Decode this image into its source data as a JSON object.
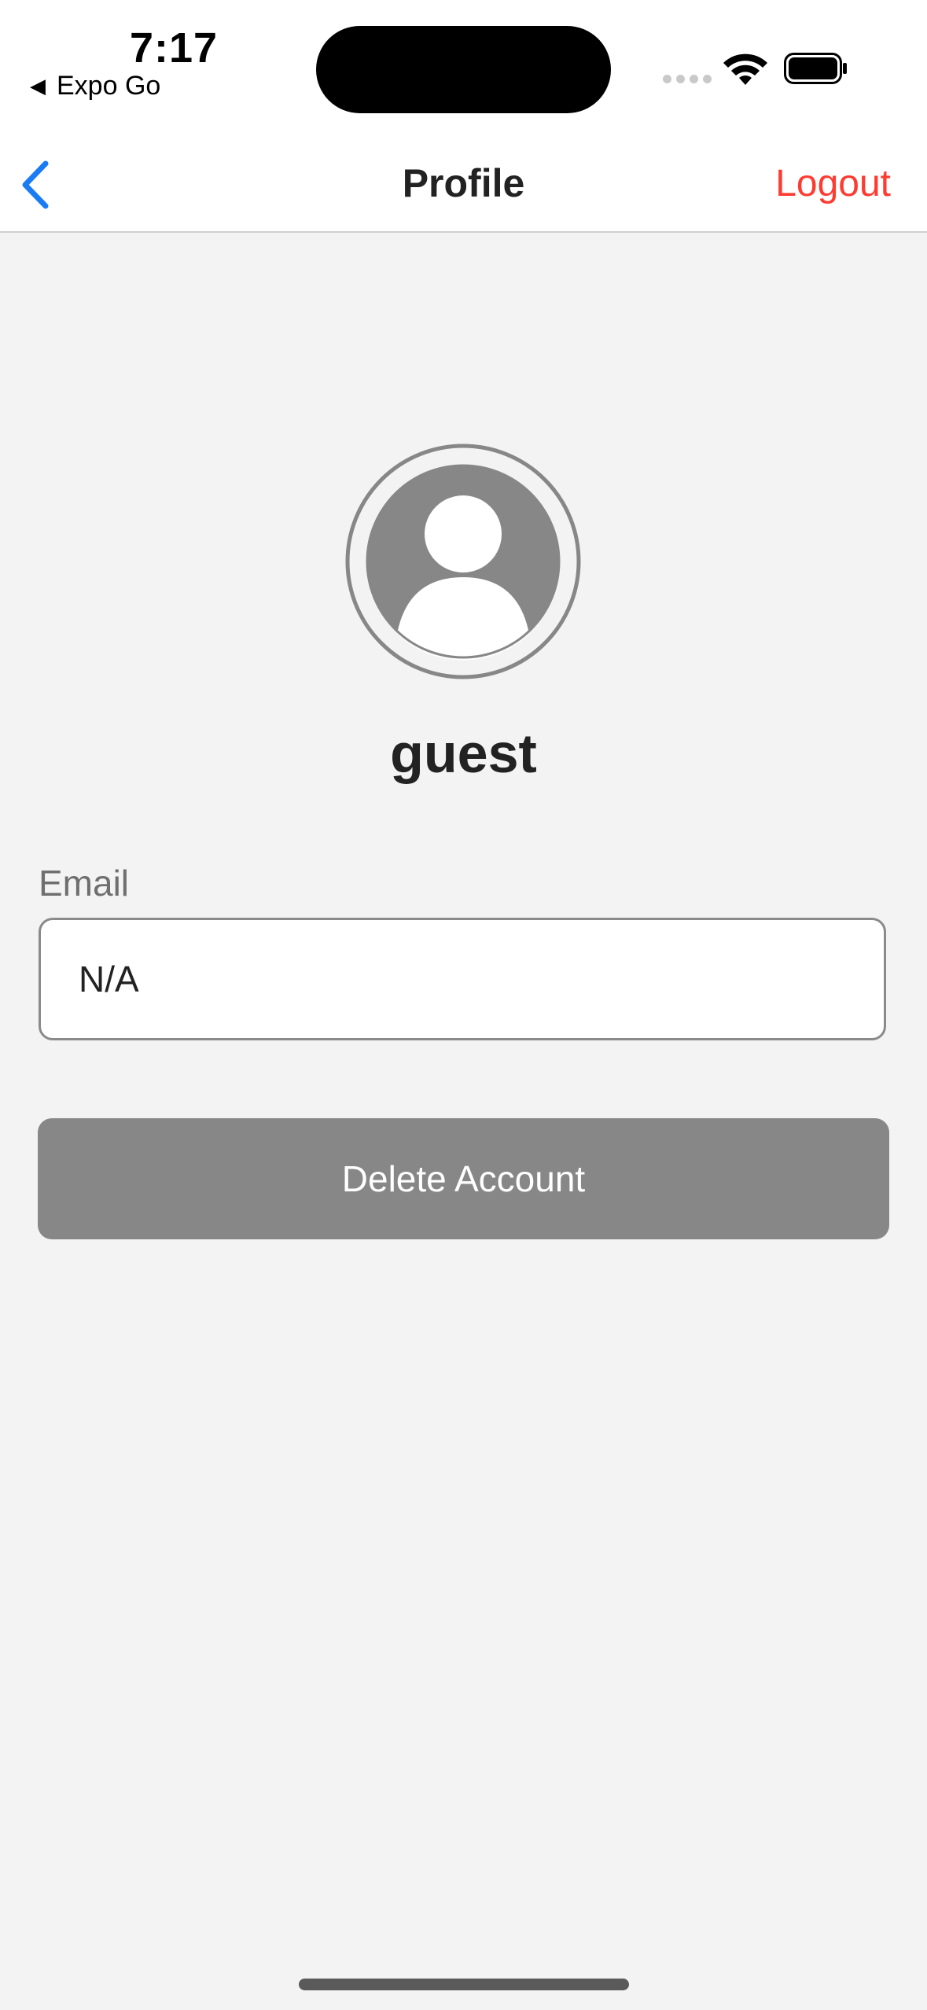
{
  "status_bar": {
    "time": "7:17",
    "back_app_label": "Expo Go",
    "back_app_icon": "left-triangle-icon",
    "icons": [
      "signal-icon",
      "wifi-icon",
      "battery-icon"
    ]
  },
  "nav": {
    "title": "Profile",
    "back_icon": "chevron-left-icon",
    "logout_label": "Logout"
  },
  "profile": {
    "avatar_icon": "user-avatar-icon",
    "username": "guest"
  },
  "form": {
    "email_label": "Email",
    "email_value": "N/A"
  },
  "actions": {
    "delete_label": "Delete Account"
  },
  "colors": {
    "accent_blue": "#1a7cf5",
    "logout_red": "#ff3b30",
    "button_gray": "#888787",
    "background": "#f3f3f3"
  }
}
